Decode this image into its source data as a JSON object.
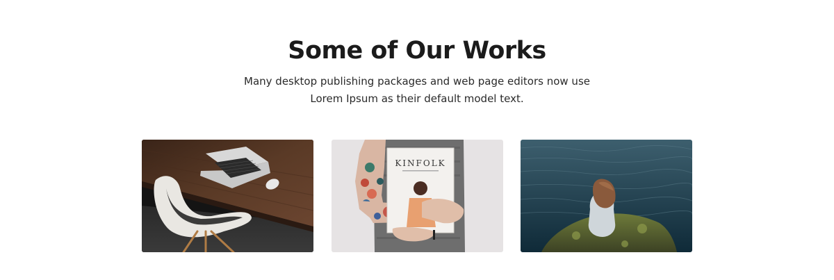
{
  "works": {
    "title": "Some of Our Works",
    "subtitle_line1": "Many desktop publishing packages and web page editors now use",
    "subtitle_line2": "Lorem Ipsum as their default model text."
  },
  "gallery": {
    "items": [
      {
        "image": "laptop-on-wooden-desk-with-white-chair"
      },
      {
        "image": "tattooed-person-holding-kinfolk-magazine",
        "magazine_title": "KINFOLK"
      },
      {
        "image": "person-sitting-on-rock-by-water"
      }
    ]
  },
  "colors": {
    "heading": "#1b1b1b",
    "body_text": "#2a2a2a",
    "background": "#ffffff"
  }
}
